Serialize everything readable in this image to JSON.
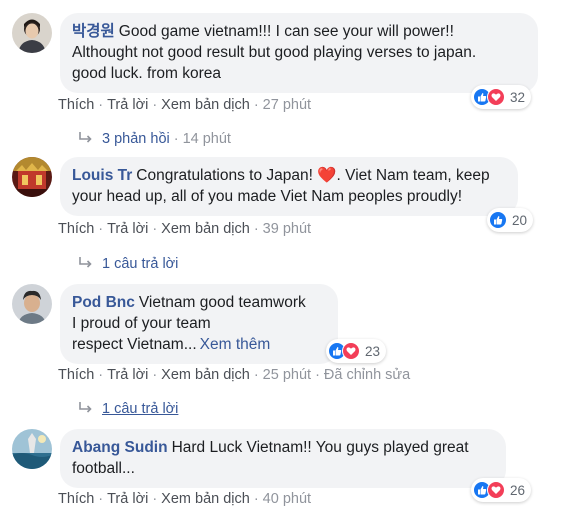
{
  "actions": {
    "like": "Thích",
    "reply": "Trả lời",
    "translate": "Xem bản dịch",
    "separator": "·"
  },
  "comments": [
    {
      "author": "박경원",
      "lines": [
        "Good game vietnam!!! I can see your will power!!",
        "Althought not good result but good playing verses to japan.",
        "good luck. from korea"
      ],
      "time": "27 phút",
      "reactions": {
        "icons": [
          "like",
          "love"
        ],
        "count": "32"
      },
      "replies": {
        "label": "3 phản hồi",
        "time": "14 phút"
      }
    },
    {
      "author": "Louis Tr",
      "lines": [
        "Congratulations to Japan! ❤️. Viet Nam team, keep",
        "your head up, all of you made Viet Nam peoples proudly!"
      ],
      "time": "39 phút",
      "reactions": {
        "icons": [
          "like"
        ],
        "count": "20"
      },
      "replies": {
        "label": "1 câu trả lời"
      }
    },
    {
      "author": "Pod Bnc",
      "lines": [
        "Vietnam good teamwork",
        "I proud of your team",
        "respect Vietnam..."
      ],
      "see_more": "Xem thêm",
      "time": "25 phút",
      "edited": "Đã chỉnh sửa",
      "reactions": {
        "icons": [
          "like",
          "love"
        ],
        "count": "23"
      },
      "replies": {
        "label": "1 câu trả lời"
      }
    },
    {
      "author": "Abang Sudin",
      "lines": [
        "Hard Luck Vietnam!! You guys played great",
        "football..."
      ],
      "time": "40 phút",
      "reactions": {
        "icons": [
          "like",
          "love"
        ],
        "count": "26"
      }
    }
  ]
}
